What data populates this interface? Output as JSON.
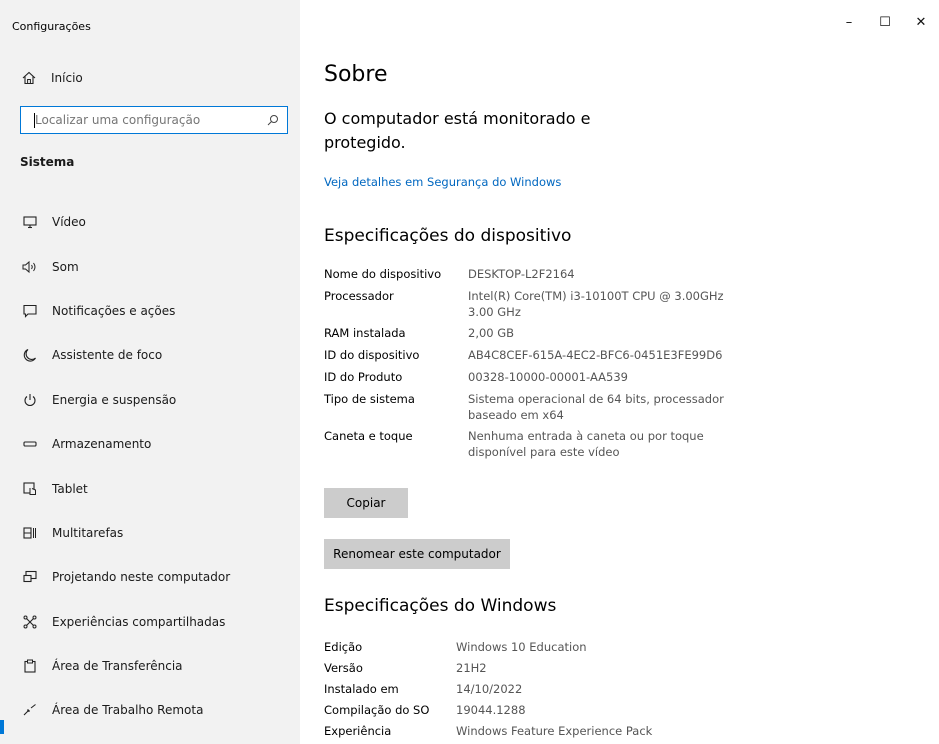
{
  "window": {
    "title": "Configurações",
    "minimize": "–",
    "maximize": "☐",
    "close": "✕"
  },
  "sidebar": {
    "home_label": "Início",
    "search_placeholder": "Localizar uma configuração",
    "section": "Sistema",
    "items": [
      {
        "label": "Vídeo",
        "icon": "monitor-icon"
      },
      {
        "label": "Som",
        "icon": "speaker-icon"
      },
      {
        "label": "Notificações e ações",
        "icon": "notification-icon"
      },
      {
        "label": "Assistente de foco",
        "icon": "moon-icon"
      },
      {
        "label": "Energia e suspensão",
        "icon": "power-icon"
      },
      {
        "label": "Armazenamento",
        "icon": "storage-icon"
      },
      {
        "label": "Tablet",
        "icon": "tablet-icon"
      },
      {
        "label": "Multitarefas",
        "icon": "multitask-icon"
      },
      {
        "label": "Projetando neste computador",
        "icon": "projecting-icon"
      },
      {
        "label": "Experiências compartilhadas",
        "icon": "shared-icon"
      },
      {
        "label": "Área de Transferência",
        "icon": "clipboard-icon"
      },
      {
        "label": "Área de Trabalho Remota",
        "icon": "remote-desktop-icon"
      }
    ]
  },
  "main": {
    "title": "Sobre",
    "protection": "O computador está monitorado e protegido.",
    "security_link": "Veja detalhes em Segurança do Windows",
    "device_heading": "Especificações do dispositivo",
    "device_specs": [
      {
        "key": "Nome do dispositivo",
        "value": "DESKTOP-L2F2164"
      },
      {
        "key": "Processador",
        "value": "Intel(R) Core(TM) i3-10100T CPU @ 3.00GHz 3.00 GHz"
      },
      {
        "key": "RAM instalada",
        "value": "2,00 GB"
      },
      {
        "key": "ID do dispositivo",
        "value": "AB4C8CEF-615A-4EC2-BFC6-0451E3FE99D6"
      },
      {
        "key": "ID do Produto",
        "value": "00328-10000-00001-AA539"
      },
      {
        "key": "Tipo de sistema",
        "value": "Sistema operacional de 64 bits, processador baseado em x64"
      },
      {
        "key": "Caneta e toque",
        "value": "Nenhuma entrada à caneta ou por toque disponível para este vídeo"
      }
    ],
    "copy_button": "Copiar",
    "rename_button": "Renomear este computador",
    "windows_heading": "Especificações do Windows",
    "windows_specs": [
      {
        "key": "Edição",
        "value": "Windows 10 Education"
      },
      {
        "key": "Versão",
        "value": "21H2"
      },
      {
        "key": "Instalado em",
        "value": "14/10/2022"
      },
      {
        "key": "Compilação do SO",
        "value": "19044.1288"
      },
      {
        "key": "Experiência",
        "value": "Windows Feature Experience Pack"
      }
    ]
  },
  "colors": {
    "accent": "#0078d7",
    "link": "#0067c0",
    "sidebar_bg": "#f2f2f2",
    "button_bg": "#cccccc"
  }
}
